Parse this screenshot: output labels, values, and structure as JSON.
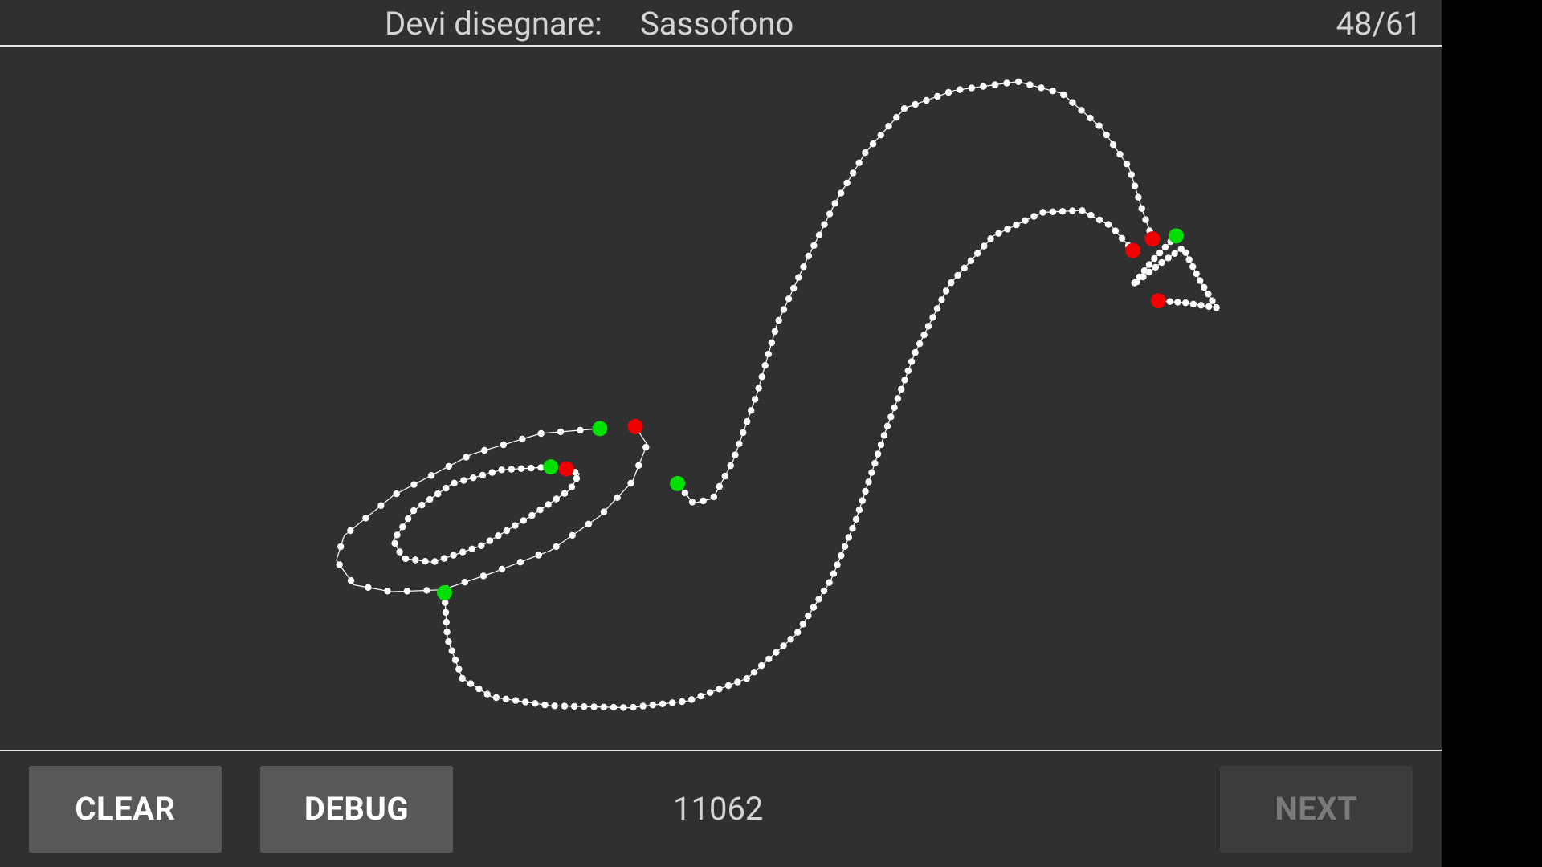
{
  "header": {
    "prompt_label": "Devi disegnare:",
    "prompt_word": "Sassofono",
    "progress": "48/61"
  },
  "footer": {
    "clear_label": "CLEAR",
    "debug_label": "DEBUG",
    "score": "11062",
    "next_label": "NEXT"
  },
  "colors": {
    "background": "#303030",
    "stroke": "#ffffff",
    "start_marker": "#00e000",
    "end_marker": "#f00000"
  }
}
